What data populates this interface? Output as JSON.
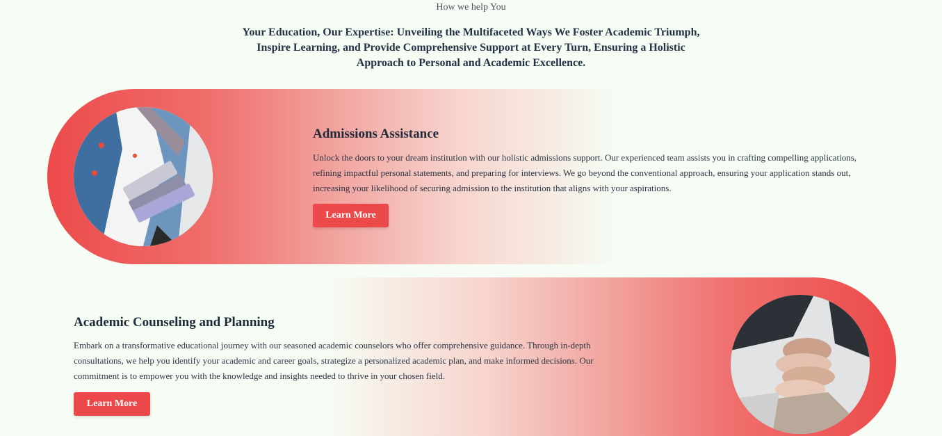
{
  "section": {
    "eyebrow": "How we help You",
    "headline": "Your Education, Our Expertise: Unveiling the Multifaceted Ways We Foster Academic Triumph, Inspire Learning, and Provide Comprehensive Support at Every Turn, Ensuring a Holistic Approach to Personal and Academic Excellence."
  },
  "services": [
    {
      "title": "Admissions Assistance",
      "description": "Unlock the doors to your dream institution with our holistic admissions support. Our experienced team assists you in crafting compelling applications, refining impactful personal statements, and preparing for interviews. We go beyond the conventional approach, ensuring your application stands out, increasing your likelihood of securing admission to the institution that aligns with your aspirations.",
      "button_label": "Learn More",
      "image": "student-holding-books-photo"
    },
    {
      "title": "Academic Counseling and Planning",
      "description": "Embark on a transformative educational journey with our seasoned academic counselors who offer comprehensive guidance. Through in-depth consultations, we help you identify your academic and career goals, strategize a personalized academic plan, and make informed decisions. Our commitment is to empower you with the knowledge and insights needed to thrive in your chosen field.",
      "button_label": "Learn More",
      "image": "stacked-hands-photo"
    }
  ],
  "colors": {
    "accent": "#ec4a4a",
    "background": "#f6fdf4",
    "text": "#1f2a3a"
  }
}
